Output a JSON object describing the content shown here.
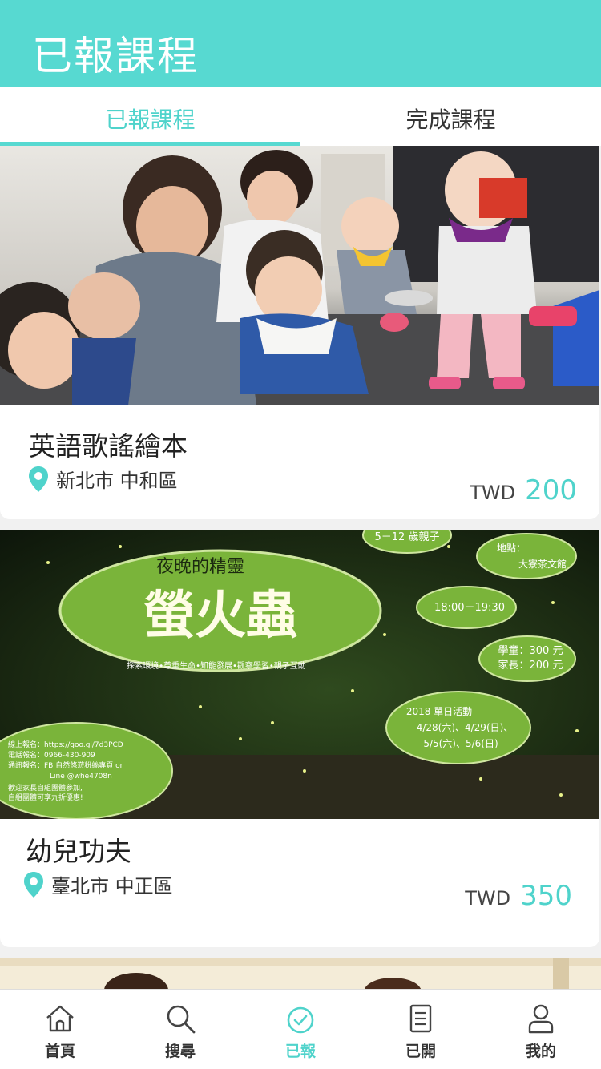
{
  "header": {
    "title": "已報課程"
  },
  "tabs": [
    {
      "label": "已報課程",
      "active": true
    },
    {
      "label": "完成課程",
      "active": false
    }
  ],
  "courses": [
    {
      "title": "英語歌謠繪本",
      "location": "新北市 中和區",
      "currency": "TWD",
      "price": "200",
      "image": "photo-babies-music-class"
    },
    {
      "title": "幼兒功夫",
      "location": "臺北市 中正區",
      "currency": "TWD",
      "price": "350",
      "image": "poster-fireflies-night",
      "poster": {
        "age": "5－12 歲親子",
        "place_label": "地點：",
        "place": "大寮茶文館",
        "heading": "夜晚的精靈",
        "big": "螢火蟲",
        "tagline": "探索環境•尊重生命•知能發展•觀察學習•親子互動",
        "time": "18:00－19:30",
        "fee_child": "學童：300 元",
        "fee_parent": "家長：200 元",
        "event_label": "2018 單日活動",
        "dates_1": "4/28(六)、4/29(日)、",
        "dates_2": "5/5(六)、5/6(日)",
        "signup_1": "線上報名：https://goo.gl/7d3PCD",
        "signup_2": "電話報名：0966-430-909",
        "signup_3": "通訊報名：FB 自然悠遊粉絲專頁 or",
        "signup_4": "Line @whe4708n",
        "signup_5": "歡迎家長自組團體參加,",
        "signup_6": "自組團體可享九折優惠!"
      }
    }
  ],
  "tabbar": [
    {
      "label": "首頁",
      "icon": "home-icon",
      "active": false
    },
    {
      "label": "搜尋",
      "icon": "search-icon",
      "active": false
    },
    {
      "label": "已報",
      "icon": "check-circle-icon",
      "active": true
    },
    {
      "label": "已開",
      "icon": "document-icon",
      "active": false
    },
    {
      "label": "我的",
      "icon": "user-icon",
      "active": false
    }
  ],
  "colors": {
    "accent": "#57d9d1",
    "accent_text": "#4fd3cb"
  }
}
